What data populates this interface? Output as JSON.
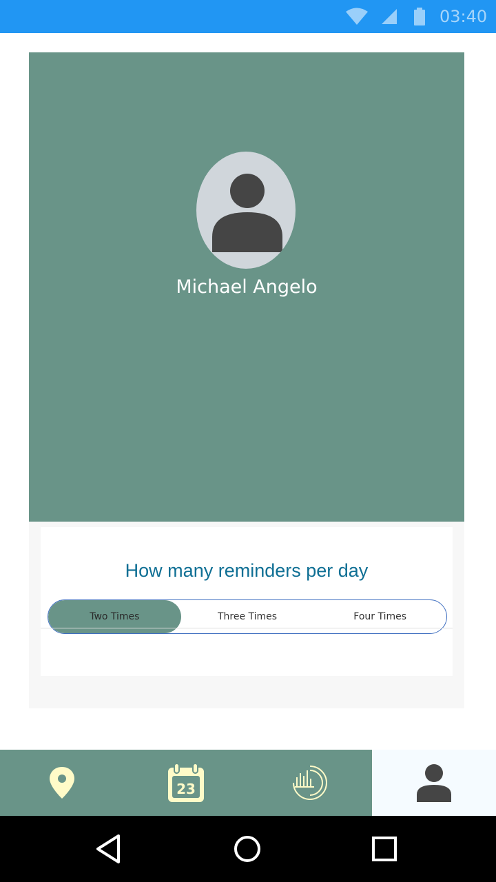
{
  "status_bar": {
    "time": "03:40",
    "icons": [
      "wifi-icon",
      "signal-icon",
      "battery-icon"
    ],
    "color": "#2196f3"
  },
  "profile": {
    "name": "Michael Angelo",
    "avatar_icon": "person-icon",
    "card_color": "#699488"
  },
  "reminders": {
    "title": "How many reminders per day",
    "options": [
      "Two Times",
      "Three Times",
      "Four Times"
    ],
    "selected": "Two Times",
    "title_color": "#0f6f94"
  },
  "bottom_nav": {
    "items": [
      {
        "icon": "map-pin-icon",
        "active": false
      },
      {
        "icon": "calendar-icon",
        "label": "23",
        "active": false
      },
      {
        "icon": "stats-icon",
        "active": false
      },
      {
        "icon": "profile-icon",
        "active": true
      }
    ],
    "accent": "#fffbc8"
  },
  "system_nav": {
    "icons": [
      "back-icon",
      "home-icon",
      "recents-icon"
    ]
  }
}
